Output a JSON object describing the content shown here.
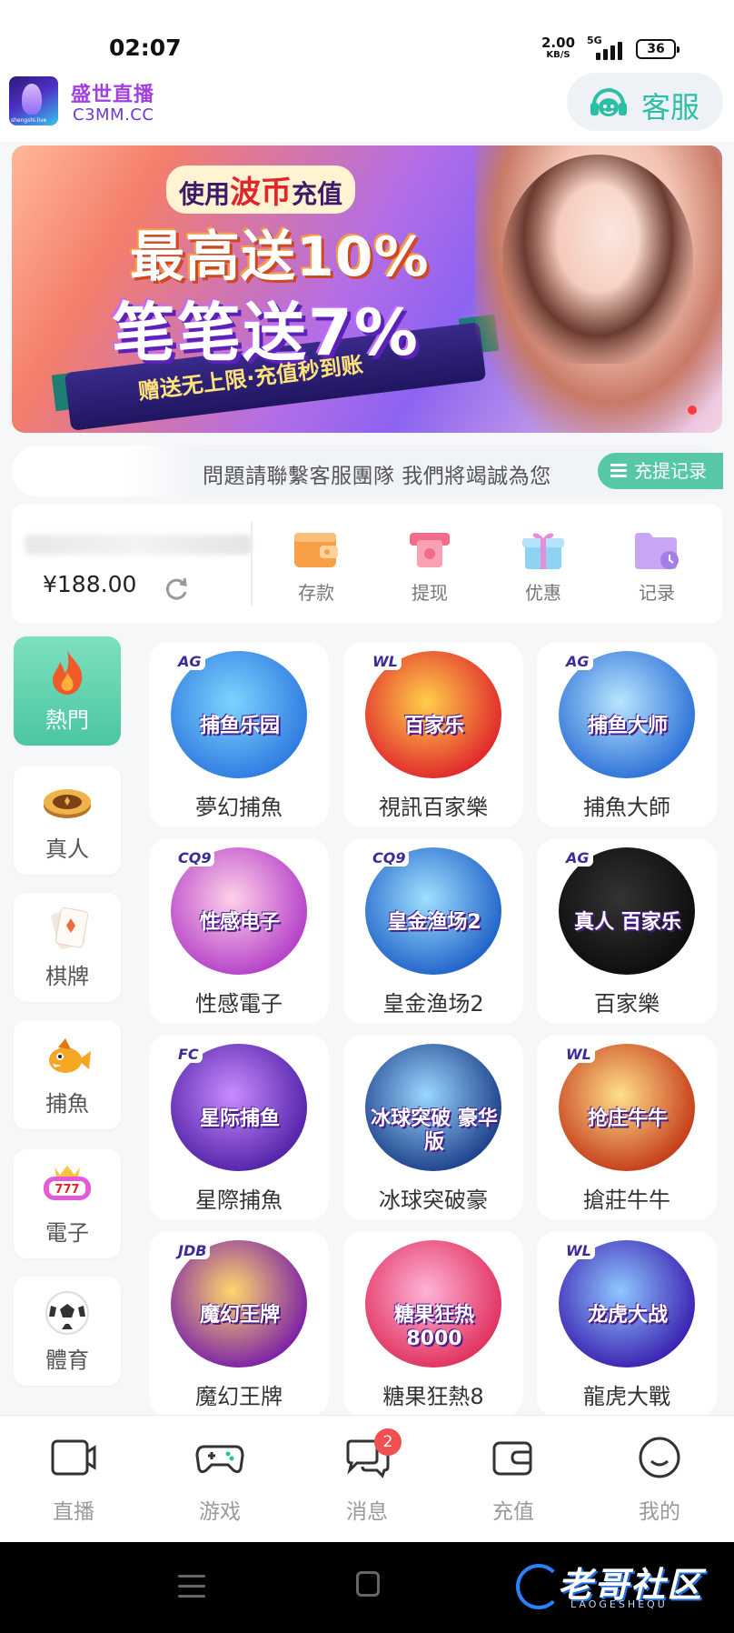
{
  "status_bar": {
    "time": "02:07",
    "net_speed": "2.00",
    "net_unit": "KB/S",
    "network": "5G",
    "battery": "36"
  },
  "header": {
    "brand_name": "盛世直播",
    "brand_domain": "C3MM.CC",
    "service_label": "客服"
  },
  "banner": {
    "line1_prefix": "使用",
    "line1_highlight": "波币",
    "line1_suffix": "充值",
    "line2": "最高送10%",
    "line3": "笔笔送7%",
    "line4": "赠送无上限·充值秒到账"
  },
  "marquee": {
    "text": "問題請聯繫客服團隊 我們將竭誠為您",
    "record_label": "充提记录"
  },
  "wallet": {
    "balance": "¥188.00",
    "actions": [
      {
        "label": "存款",
        "icon": "wallet-icon"
      },
      {
        "label": "提现",
        "icon": "withdraw-icon"
      },
      {
        "label": "优惠",
        "icon": "gift-icon"
      },
      {
        "label": "记录",
        "icon": "record-folder-icon"
      }
    ]
  },
  "categories": [
    {
      "label": "熱門",
      "icon": "flame-icon",
      "active": true
    },
    {
      "label": "真人",
      "icon": "casino-chip-icon",
      "active": false
    },
    {
      "label": "棋牌",
      "icon": "playing-card-icon",
      "active": false
    },
    {
      "label": "捕魚",
      "icon": "fish-icon",
      "active": false
    },
    {
      "label": "電子",
      "icon": "slot-machine-icon",
      "active": false
    },
    {
      "label": "體育",
      "icon": "soccer-ball-icon",
      "active": false
    }
  ],
  "games": [
    {
      "label": "夢幻捕魚",
      "brand": "AG",
      "art_title": "捕鱼乐园"
    },
    {
      "label": "視訊百家樂",
      "brand": "WL",
      "art_title": "百家乐"
    },
    {
      "label": "捕魚大師",
      "brand": "AG",
      "art_title": "捕鱼大师"
    },
    {
      "label": "性感電子",
      "brand": "CQ9",
      "art_title": "性感电子"
    },
    {
      "label": "皇金渔场2",
      "brand": "CQ9",
      "art_title": "皇金渔场2"
    },
    {
      "label": "百家樂",
      "brand": "AG",
      "art_title": "真人 百家乐"
    },
    {
      "label": "星際捕魚",
      "brand": "FC",
      "art_title": "星际捕鱼"
    },
    {
      "label": "冰球突破豪",
      "brand": "",
      "art_title": "冰球突破 豪华版"
    },
    {
      "label": "搶莊牛牛",
      "brand": "WL",
      "art_title": "抢庄牛牛"
    },
    {
      "label": "魔幻王牌",
      "brand": "JDB",
      "art_title": "魔幻王牌"
    },
    {
      "label": "糖果狂熱8",
      "brand": "",
      "art_title": "糖果狂热 8000"
    },
    {
      "label": "龍虎大戰",
      "brand": "WL",
      "art_title": "龙虎大战"
    }
  ],
  "bottom_nav": [
    {
      "label": "直播",
      "icon": "video-camera-icon"
    },
    {
      "label": "游戏",
      "icon": "gamepad-icon"
    },
    {
      "label": "消息",
      "icon": "chat-bubble-icon"
    },
    {
      "label": "充值",
      "icon": "wallet-icon"
    },
    {
      "label": "我的",
      "icon": "smiley-icon"
    }
  ],
  "message_badge": "2",
  "watermark": {
    "text": "老哥社区",
    "sub": "LAOGESHEQU"
  },
  "colors": {
    "accent": "#4bc6a0",
    "brand_purple": "#a23fe0",
    "badge_red": "#f25050"
  }
}
